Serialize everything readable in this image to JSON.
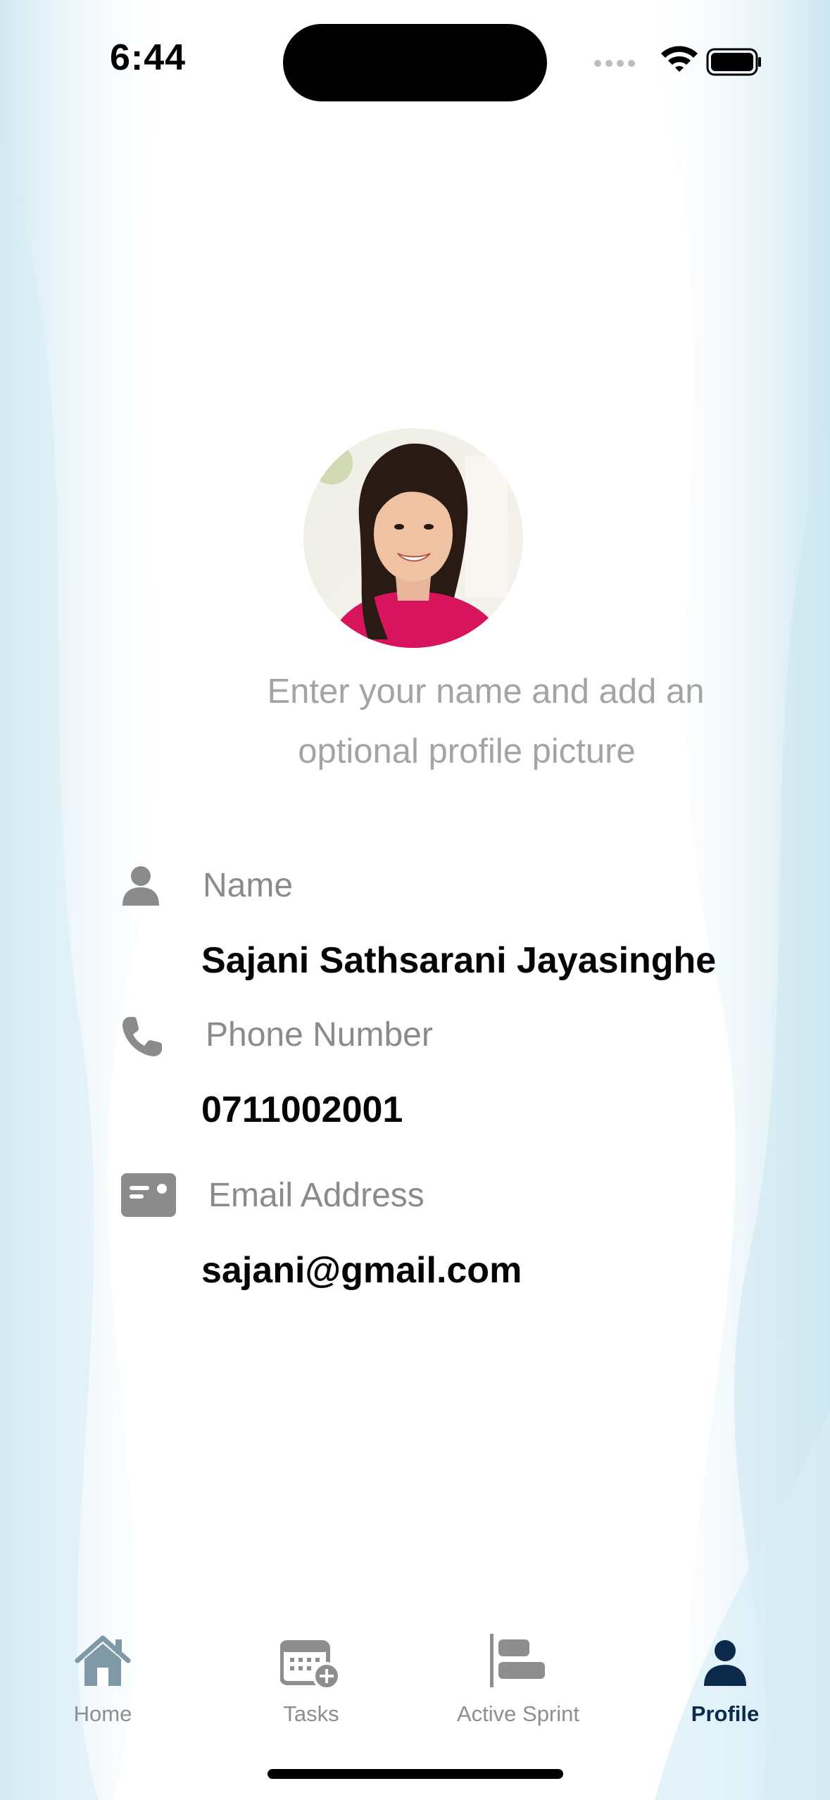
{
  "status_bar": {
    "time": "6:44"
  },
  "profile": {
    "avatar_alt": "Profile photo",
    "hint_line1": "Enter your name and add an",
    "hint_line2": "optional profile picture"
  },
  "fields": {
    "name": {
      "label": "Name",
      "value": "Sajani Sathsarani Jayasinghe",
      "icon": "person-icon"
    },
    "phone": {
      "label": "Phone Number",
      "value": "0711002001",
      "icon": "phone-icon"
    },
    "email": {
      "label": "Email Address",
      "value": "sajani@gmail.com",
      "icon": "id-card-icon"
    }
  },
  "tab_bar": {
    "items": [
      {
        "label": "Home",
        "icon": "home-icon",
        "active": false
      },
      {
        "label": "Tasks",
        "icon": "calendar-add-icon",
        "active": false
      },
      {
        "label": "Active Sprint",
        "icon": "sprint-bars-icon",
        "active": false
      },
      {
        "label": "Profile",
        "icon": "person-icon",
        "active": true
      }
    ]
  },
  "colors": {
    "active_tab": "#0b2a4c",
    "inactive_tab": "#8e8e8e",
    "home_icon": "#7f9aa6",
    "label_gray": "#8b8b8b",
    "hint_gray": "#a4a4a4",
    "background_tint": "#cfe9f3"
  }
}
